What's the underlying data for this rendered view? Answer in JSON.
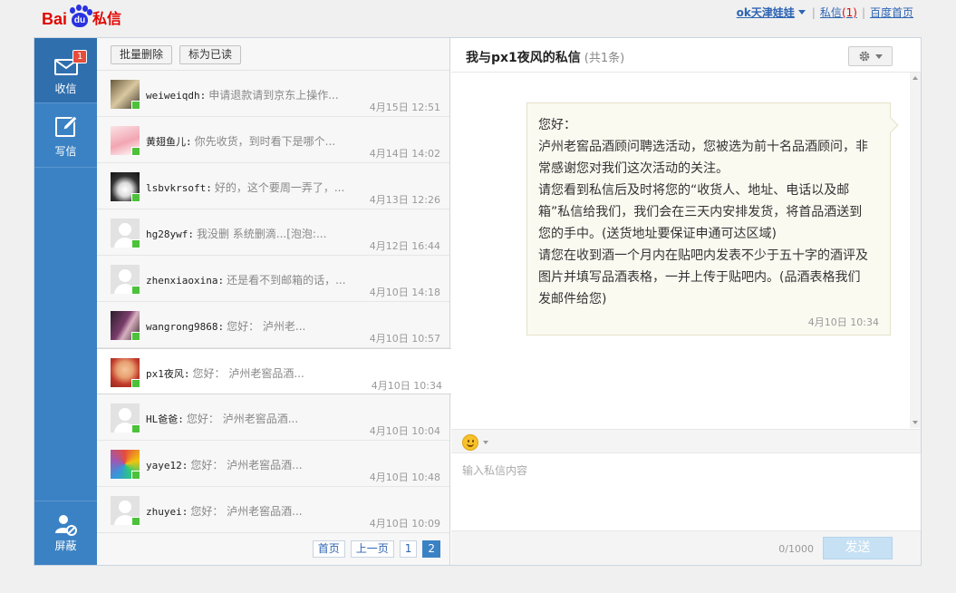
{
  "brand": {
    "bai": "Bai",
    "du": "du",
    "title": "私信"
  },
  "toplinks": {
    "user": "ok天津娃娃",
    "sixin": "私信",
    "sixin_count": "(1)",
    "home": "百度首页",
    "sep": "|"
  },
  "nav": {
    "inbox": {
      "label": "收信",
      "badge": "1"
    },
    "compose": {
      "label": "写信"
    },
    "block": {
      "label": "屏蔽"
    }
  },
  "toolbar": {
    "batch_delete": "批量删除",
    "mark_read": "标为已读"
  },
  "conversations": [
    {
      "name": "weiweiqdh:",
      "preview": "申请退款请到京东上操作...",
      "time": "4月15日 12:51"
    },
    {
      "name": "黄翅鱼儿:",
      "preview": "你先收货，到时看下是哪个...",
      "time": "4月14日 14:02"
    },
    {
      "name": "lsbvkrsoft:",
      "preview": "好的，这个要周一弄了，...",
      "time": "4月13日 12:26"
    },
    {
      "name": "hg28ywf:",
      "preview": "我没删 系统删滴...[泡泡:...",
      "time": "4月12日 16:44"
    },
    {
      "name": "zhenxiaoxina:",
      "preview": "还是看不到邮箱的话，...",
      "time": "4月10日 14:18"
    },
    {
      "name": "wangrong9868:",
      "preview": "您好： 泸州老...",
      "time": "4月10日 10:57"
    },
    {
      "name": "px1夜风:",
      "preview": "您好： 泸州老窖品酒...",
      "time": "4月10日 10:34"
    },
    {
      "name": "HL爸爸:",
      "preview": "您好： 泸州老窖品酒...",
      "time": "4月10日 10:04"
    },
    {
      "name": "yaye12:",
      "preview": "您好： 泸州老窖品酒...",
      "time": "4月10日 10:48"
    },
    {
      "name": "zhuyei:",
      "preview": "您好： 泸州老窖品酒...",
      "time": "4月10日 10:09"
    }
  ],
  "pager": {
    "first": "首页",
    "prev": "上一页",
    "p1": "1",
    "p2": "2"
  },
  "chat": {
    "title": "我与px1夜风的私信",
    "count": "(共1条)",
    "message": {
      "lines": [
        "您好：",
        "泸州老窖品酒顾问聘选活动，您被选为前十名品酒顾问，非",
        "常感谢您对我们这次活动的关注。",
        "请您看到私信后及时将您的“收货人、地址、电话以及邮",
        "箱”私信给我们，我们会在三天内安排发货，将首品酒送到",
        "您的手中。(送货地址要保证申通可达区域)",
        "请您在收到酒一个月内在贴吧内发表不少于五十字的酒评及",
        "图片并填写品酒表格，一并上传于贴吧内。(品酒表格我们",
        "发邮件给您)"
      ],
      "time": "4月10日 10:34"
    },
    "input_placeholder": "输入私信内容",
    "word_count": "0/1000",
    "send": "发送"
  },
  "colors": {
    "nav_bg": "#3b82c4",
    "brand_red": "#e10601",
    "brand_blue": "#2932e1",
    "link": "#2d64b3",
    "online": "#4cc23a"
  }
}
